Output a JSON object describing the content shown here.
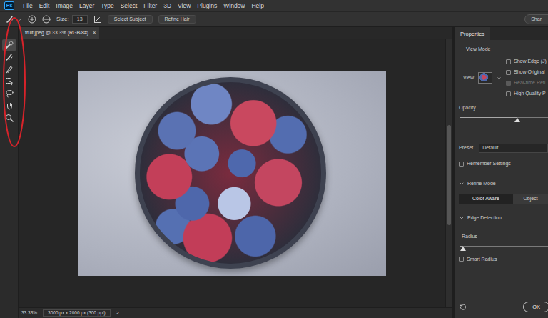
{
  "app": {
    "logo": "Ps"
  },
  "menu": [
    "File",
    "Edit",
    "Image",
    "Layer",
    "Type",
    "Select",
    "Filter",
    "3D",
    "View",
    "Plugins",
    "Window",
    "Help"
  ],
  "options": {
    "size_label": "Size:",
    "size_value": "13",
    "buttons": [
      "Select Subject",
      "Refine Hair"
    ],
    "share": "Shar"
  },
  "tools": [
    {
      "kind": "quick-select",
      "selected": true
    },
    {
      "kind": "refine-brush",
      "selected": false
    },
    {
      "kind": "brush",
      "selected": false
    },
    {
      "kind": "object-select",
      "selected": false
    },
    {
      "kind": "lasso",
      "selected": false
    },
    {
      "kind": "hand",
      "selected": false
    },
    {
      "kind": "zoom",
      "selected": false
    }
  ],
  "document": {
    "tab": "fruit.jpeg @ 33.3% (RGB/8#)",
    "close": "×",
    "selected": true
  },
  "status_bar": {
    "zoom": "33.33%",
    "dimensions": "3000 px x 2000 px (300 ppi)",
    "arrow": ">"
  },
  "properties": {
    "title": "Properties",
    "view_mode": {
      "heading": "View Mode",
      "view_label": "View",
      "options": [
        {
          "label": "Show Edge (J)",
          "checked": false,
          "disabled": false
        },
        {
          "label": "Show Original",
          "checked": false,
          "disabled": false
        },
        {
          "label": "Real-time Refi",
          "checked": true,
          "disabled": true
        },
        {
          "label": "High Quality P",
          "checked": false,
          "disabled": false
        }
      ]
    },
    "opacity": {
      "label": "Opacity",
      "level": 0.65
    },
    "preset": {
      "label": "Preset",
      "value": "Default"
    },
    "remember": {
      "label": "Remember Settings",
      "checked": false
    },
    "refine_mode": {
      "heading": "Refine Mode",
      "expanded": true,
      "modes": [
        {
          "label": "Color Aware",
          "selected": true
        },
        {
          "label": "Object",
          "selected": false
        }
      ]
    },
    "edge_detection": {
      "heading": "Edge Detection",
      "expanded": true,
      "radius": {
        "label": "Radius",
        "level": 0.03
      },
      "smart_radius": {
        "label": "Smart Radius",
        "checked": false
      }
    },
    "buttons": [
      "OK"
    ]
  }
}
